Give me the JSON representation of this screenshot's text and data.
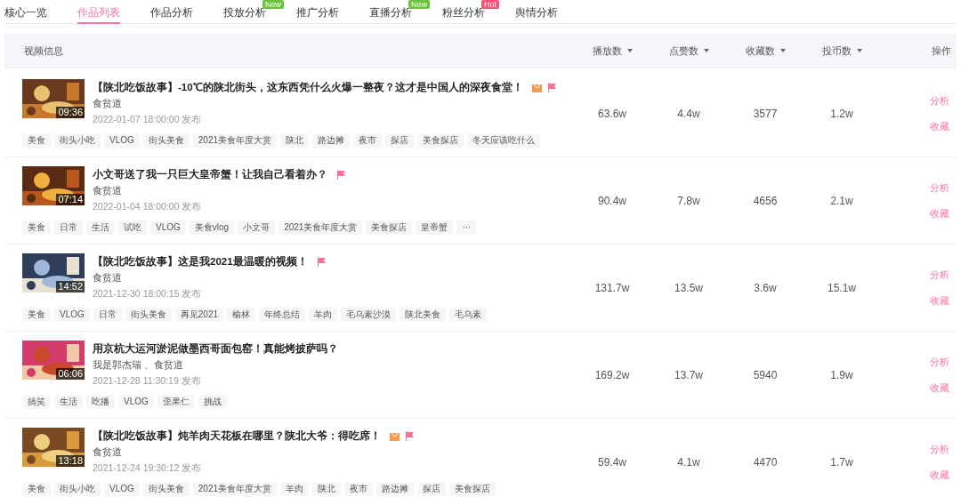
{
  "tabs": [
    {
      "label": "核心一览",
      "selected": false
    },
    {
      "label": "作品列表",
      "selected": true
    },
    {
      "label": "作品分析",
      "selected": false
    },
    {
      "label": "投放分析",
      "selected": false,
      "badge": {
        "text": "New",
        "color": "#6cc23d"
      }
    },
    {
      "label": "推广分析",
      "selected": false
    },
    {
      "label": "直播分析",
      "selected": false,
      "badge": {
        "text": "New",
        "color": "#6cc23d"
      }
    },
    {
      "label": "粉丝分析",
      "selected": false,
      "badge": {
        "text": "Hot",
        "color": "#fb5077"
      }
    },
    {
      "label": "舆情分析",
      "selected": false
    }
  ],
  "table": {
    "columns": [
      {
        "label": "视频信息",
        "sortable": false
      },
      {
        "label": "播放数",
        "sortable": true
      },
      {
        "label": "点赞数",
        "sortable": true
      },
      {
        "label": "收藏数",
        "sortable": true
      },
      {
        "label": "投币数",
        "sortable": true
      },
      {
        "label": "操作",
        "sortable": false
      }
    ],
    "rows": [
      {
        "duration": "09:36",
        "title": "【陕北吃饭故事】-10℃的陕北街头，这东西凭什么火爆一整夜？这才是中国人的深夜食堂！",
        "goods": true,
        "flagged": true,
        "author": "食贫道",
        "date": "2022-01-07 18:00:00 发布",
        "tags": [
          "美食",
          "街头小吃",
          "VLOG",
          "街头美食",
          "2021美食年度大赏",
          "陕北",
          "路边摊",
          "夜市",
          "探店",
          "美食探店",
          "冬天应该吃什么"
        ],
        "plays": "63.6w",
        "likes": "4.4w",
        "favorites": "3577",
        "coins": "1.2w",
        "actions": [
          "分析",
          "收藏"
        ]
      },
      {
        "duration": "07:14",
        "title": "小文哥送了我一只巨大皇帝蟹！让我自己看着办？",
        "goods": false,
        "flagged": true,
        "author": "食贫道",
        "date": "2022-01-04 18:00:00 发布",
        "tags": [
          "美食",
          "日常",
          "生活",
          "试吃",
          "VLOG",
          "美食vlog",
          "小文哥",
          "2021美食年度大赏",
          "美食探店",
          "皇帝蟹",
          "···"
        ],
        "plays": "90.4w",
        "likes": "7.8w",
        "favorites": "4656",
        "coins": "2.1w",
        "actions": [
          "分析",
          "收藏"
        ]
      },
      {
        "duration": "14:52",
        "title": "【陕北吃饭故事】这是我2021最温暖的视频！",
        "goods": false,
        "flagged": true,
        "author": "食贫道",
        "date": "2021-12-30 18:00:15 发布",
        "tags": [
          "美食",
          "VLOG",
          "日常",
          "街头美食",
          "再见2021",
          "榆林",
          "年终总结",
          "羊肉",
          "毛乌素沙漠",
          "陕北美食",
          "毛乌素"
        ],
        "plays": "131.7w",
        "likes": "13.5w",
        "favorites": "3.6w",
        "coins": "15.1w",
        "actions": [
          "分析",
          "收藏"
        ]
      },
      {
        "duration": "06:06",
        "title": "用京杭大运河淤泥做墨西哥面包窑！真能烤披萨吗？",
        "goods": false,
        "flagged": false,
        "author": "我是郭杰瑞 、食贫道",
        "date": "2021-12-28 11:30:19 发布",
        "tags": [
          "搞笑",
          "生活",
          "吃播",
          "VLOG",
          "歪果仁",
          "挑战"
        ],
        "plays": "169.2w",
        "likes": "13.7w",
        "favorites": "5940",
        "coins": "1.9w",
        "actions": [
          "分析",
          "收藏"
        ]
      },
      {
        "duration": "13:18",
        "title": "【陕北吃饭故事】炖羊肉天花板在哪里？陕北大爷：得吃席！",
        "goods": true,
        "flagged": true,
        "author": "食贫道",
        "date": "2021-12-24 19:30:12 发布",
        "tags": [
          "美食",
          "街头小吃",
          "VLOG",
          "街头美食",
          "2021美食年度大赏",
          "羊肉",
          "陕北",
          "夜市",
          "路边摊",
          "探店",
          "美食探店"
        ],
        "plays": "59.4w",
        "likes": "4.1w",
        "favorites": "4470",
        "coins": "1.7w",
        "actions": [
          "分析",
          "收藏"
        ]
      }
    ]
  }
}
